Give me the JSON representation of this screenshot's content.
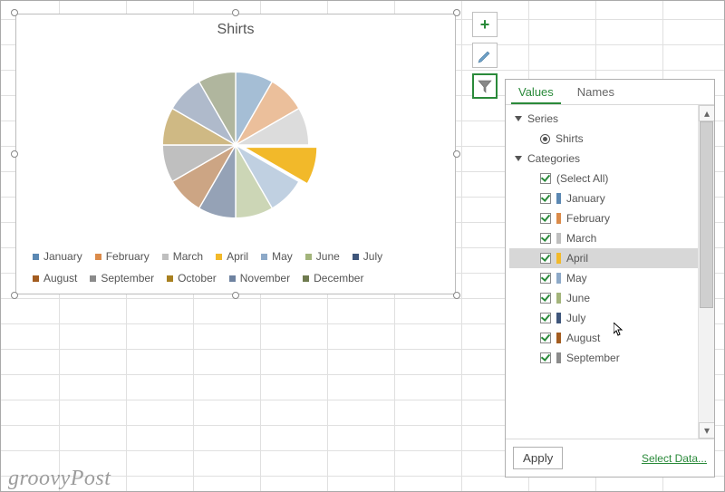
{
  "chart_data": {
    "type": "pie",
    "title": "Shirts",
    "categories": [
      "January",
      "February",
      "March",
      "April",
      "May",
      "June",
      "July",
      "August",
      "September",
      "October",
      "November",
      "December"
    ],
    "values": [
      8.3,
      8.3,
      8.3,
      8.3,
      8.3,
      8.3,
      8.3,
      8.3,
      8.3,
      8.3,
      8.3,
      8.3
    ],
    "colors": [
      "#5b88b3",
      "#db8b4a",
      "#bfbfbf",
      "#f2b92a",
      "#8da9c8",
      "#a3b47b",
      "#3f567b",
      "#a35c20",
      "#8b8b8b",
      "#a88020",
      "#6e82a0",
      "#6f7b4f"
    ],
    "exploded_index": 3
  },
  "legend": {
    "items": [
      {
        "label": "January",
        "color": "#5b88b3"
      },
      {
        "label": "February",
        "color": "#db8b4a"
      },
      {
        "label": "March",
        "color": "#bfbfbf"
      },
      {
        "label": "April",
        "color": "#f2b92a"
      },
      {
        "label": "May",
        "color": "#8da9c8"
      },
      {
        "label": "June",
        "color": "#a3b47b"
      },
      {
        "label": "July",
        "color": "#3f567b"
      },
      {
        "label": "August",
        "color": "#a35c20"
      },
      {
        "label": "September",
        "color": "#8b8b8b"
      },
      {
        "label": "October",
        "color": "#a88020"
      },
      {
        "label": "November",
        "color": "#6e82a0"
      },
      {
        "label": "December",
        "color": "#6f7b4f"
      }
    ]
  },
  "filter": {
    "tab_values": "Values",
    "tab_names": "Names",
    "series_label": "Series",
    "series_option": "Shirts",
    "categories_label": "Categories",
    "select_all": "(Select All)",
    "months": [
      "January",
      "February",
      "March",
      "April",
      "May",
      "June",
      "July",
      "August",
      "September"
    ],
    "hovered": "April",
    "apply": "Apply",
    "select_data": "Select Data..."
  },
  "watermark": "groovyPost"
}
